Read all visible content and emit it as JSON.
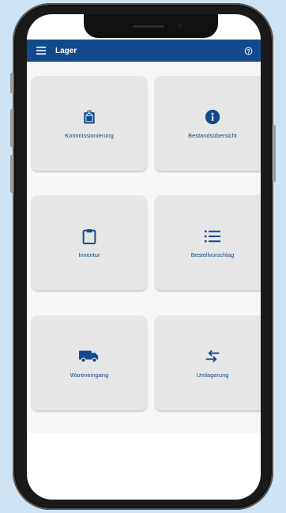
{
  "header": {
    "title": "Lager",
    "background_color": "#134a8e",
    "menu_icon": "hamburger-menu-icon",
    "help_icon": "help-circle-icon"
  },
  "tiles": [
    {
      "label": "Kommissionierung",
      "icon": "briefcase-clipboard-icon"
    },
    {
      "label": "Bestandsübersicht",
      "icon": "info-circle-icon"
    },
    {
      "label": "Inventur",
      "icon": "clipboard-icon"
    },
    {
      "label": "Bestellvorschlag",
      "icon": "list-icon"
    },
    {
      "label": "Wareneingang",
      "icon": "truck-icon"
    },
    {
      "label": "Umlagerung",
      "icon": "swap-arrows-icon"
    }
  ],
  "accent_color": "#134a8e",
  "tile_color": "#e6e6e6"
}
